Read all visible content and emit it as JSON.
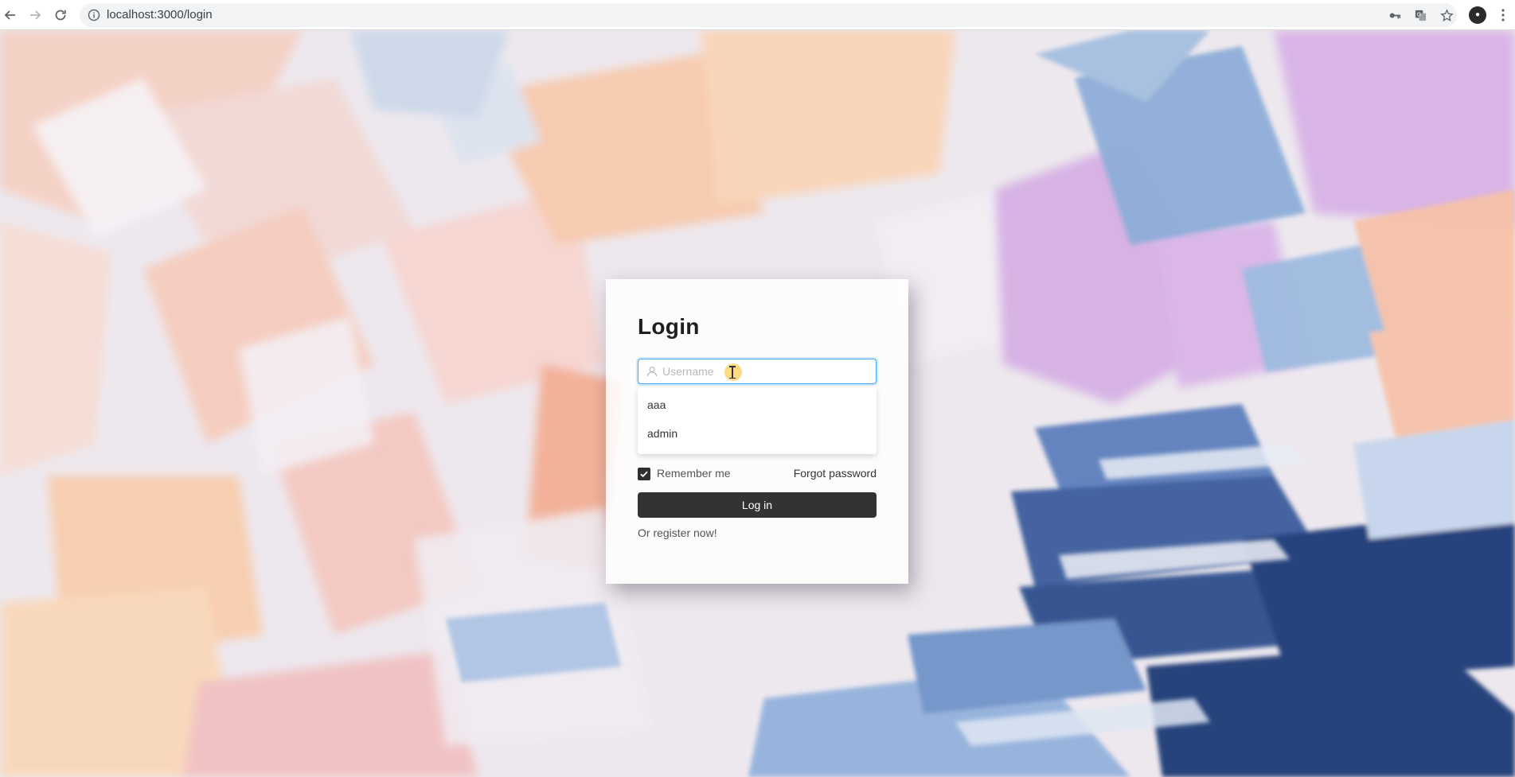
{
  "browser": {
    "url": "localhost:3000/login",
    "back_icon": "arrow-left-icon",
    "forward_icon": "arrow-right-icon",
    "reload_icon": "reload-icon",
    "info_icon": "info-icon",
    "key_icon": "key-icon",
    "translate_icon": "translate-icon",
    "star_icon": "star-icon",
    "menu_icon": "kebab-menu-icon"
  },
  "login": {
    "title": "Login",
    "username_placeholder": "Username",
    "username_value": "",
    "autocomplete_options": [
      "aaa",
      "admin"
    ],
    "remember_label": "Remember me",
    "remember_checked": true,
    "forgot_label": "Forgot password",
    "submit_label": "Log in",
    "register_label": "Or register now!"
  },
  "colors": {
    "button": "#333333",
    "focus_border": "#40a9ff",
    "checkbox": "#2f2f2f"
  }
}
